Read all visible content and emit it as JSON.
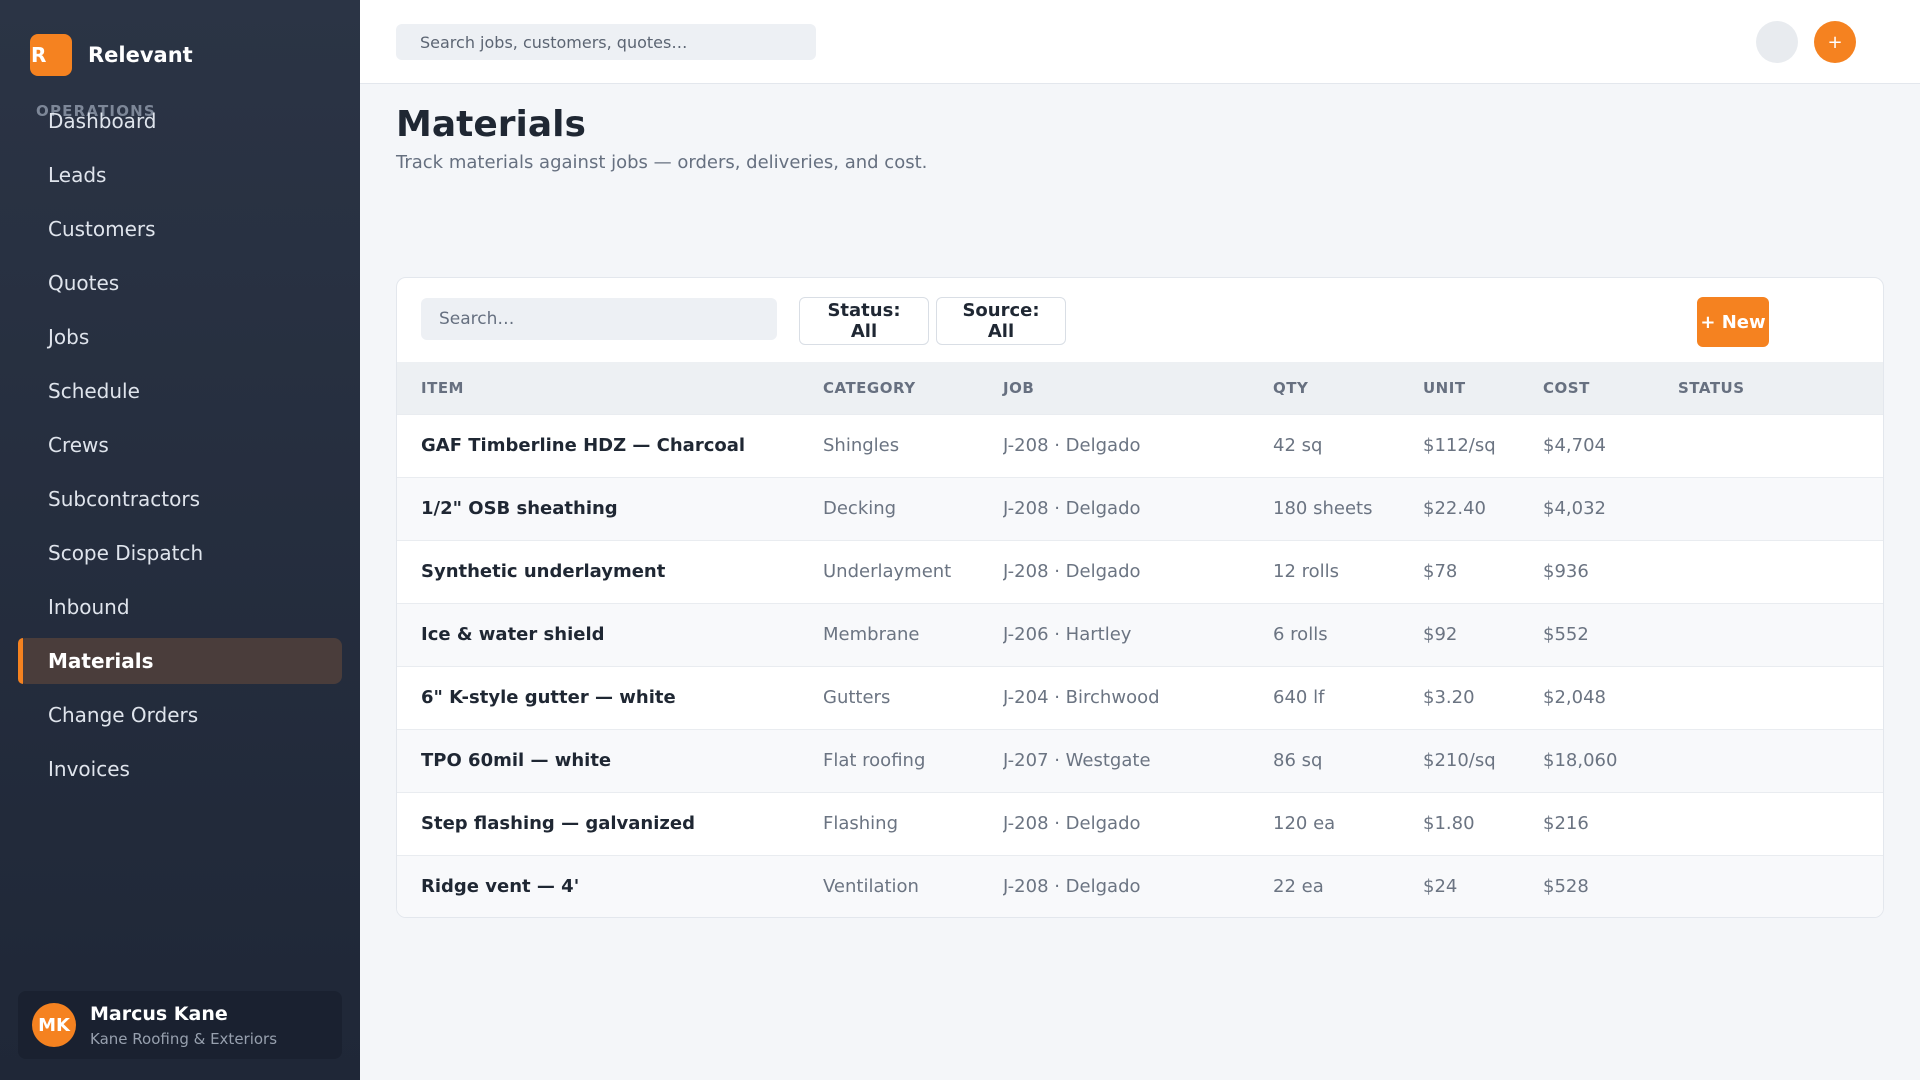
{
  "brand": {
    "logo_letter": "R",
    "name": "Relevant"
  },
  "sidebar": {
    "section_label": "OPERATIONS",
    "items": [
      {
        "label": "Dashboard"
      },
      {
        "label": "Leads"
      },
      {
        "label": "Customers"
      },
      {
        "label": "Quotes"
      },
      {
        "label": "Jobs"
      },
      {
        "label": "Schedule"
      },
      {
        "label": "Crews"
      },
      {
        "label": "Subcontractors"
      },
      {
        "label": "Scope Dispatch"
      },
      {
        "label": "Inbound"
      },
      {
        "label": "Materials",
        "active": true
      },
      {
        "label": "Change Orders"
      },
      {
        "label": "Invoices"
      }
    ],
    "user": {
      "initials": "MK",
      "name": "Marcus Kane",
      "company": "Kane Roofing & Exteriors"
    }
  },
  "topbar": {
    "search_placeholder": "Search jobs, customers, quotes…",
    "add_label": "+"
  },
  "page": {
    "title": "Materials",
    "subtitle": "Track materials against jobs — orders, deliveries, and cost."
  },
  "toolbar": {
    "search_placeholder": "Search…",
    "status_filter": "Status: All",
    "source_filter": "Source: All",
    "new_label": "+ New"
  },
  "table": {
    "columns": [
      "ITEM",
      "CATEGORY",
      "JOB",
      "QTY",
      "UNIT",
      "COST",
      "STATUS"
    ],
    "rows": [
      {
        "item": "GAF Timberline HDZ — Charcoal",
        "category": "Shingles",
        "job": "J-208 · Delgado",
        "qty": "42 sq",
        "unit": "$112/sq",
        "cost": "$4,704",
        "status": ""
      },
      {
        "item": "1/2\" OSB sheathing",
        "category": "Decking",
        "job": "J-208 · Delgado",
        "qty": "180 sheets",
        "unit": "$22.40",
        "cost": "$4,032",
        "status": ""
      },
      {
        "item": "Synthetic underlayment",
        "category": "Underlayment",
        "job": "J-208 · Delgado",
        "qty": "12 rolls",
        "unit": "$78",
        "cost": "$936",
        "status": ""
      },
      {
        "item": "Ice & water shield",
        "category": "Membrane",
        "job": "J-206 · Hartley",
        "qty": "6 rolls",
        "unit": "$92",
        "cost": "$552",
        "status": ""
      },
      {
        "item": "6\" K-style gutter — white",
        "category": "Gutters",
        "job": "J-204 · Birchwood",
        "qty": "640 lf",
        "unit": "$3.20",
        "cost": "$2,048",
        "status": ""
      },
      {
        "item": "TPO 60mil — white",
        "category": "Flat roofing",
        "job": "J-207 · Westgate",
        "qty": "86 sq",
        "unit": "$210/sq",
        "cost": "$18,060",
        "status": ""
      },
      {
        "item": "Step flashing — galvanized",
        "category": "Flashing",
        "job": "J-208 · Delgado",
        "qty": "120 ea",
        "unit": "$1.80",
        "cost": "$216",
        "status": ""
      },
      {
        "item": "Ridge vent — 4'",
        "category": "Ventilation",
        "job": "J-208 · Delgado",
        "qty": "22 ea",
        "unit": "$24",
        "cost": "$528",
        "status": ""
      }
    ]
  },
  "colors": {
    "accent": "#f58220",
    "sidebar_bg": "#252e3f",
    "active_nav_bg": "#4a3d3b"
  }
}
